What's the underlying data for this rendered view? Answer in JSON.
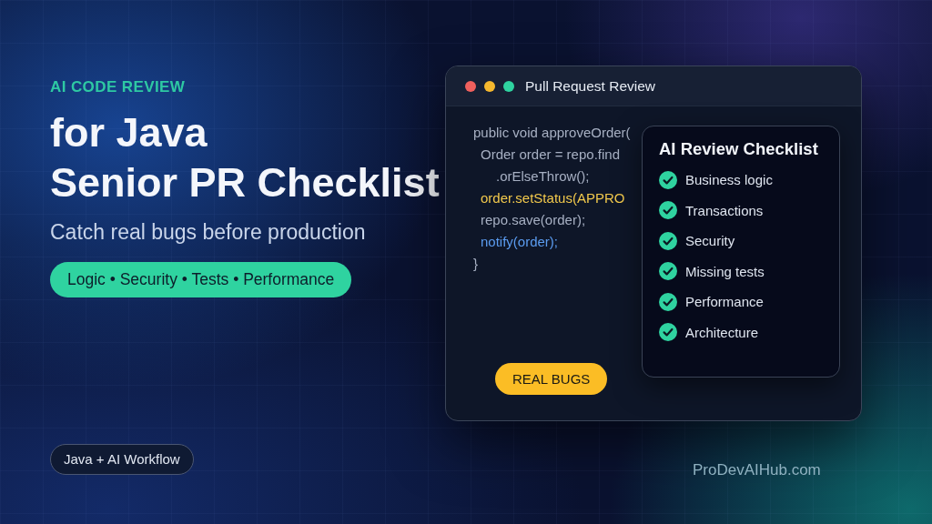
{
  "hero": {
    "eyebrow": "AI CODE REVIEW",
    "title_lines": [
      "for Java",
      "Senior PR Checklist"
    ],
    "subtitle": "Catch real bugs before production",
    "tag_pill": "Logic • Security • Tests • Performance"
  },
  "window": {
    "title": "Pull Request Review",
    "code": [
      {
        "text": "public void approveOrder(",
        "color": "#a7b0c3",
        "children": [
          {
            "text": "Order order = repo.find",
            "color": "#a7b0c3",
            "children": [
              {
                "text": ".orElseThrow();",
                "color": "#a7b0c3"
              }
            ]
          },
          {
            "text": "order.setStatus(APPRO",
            "color": "#f2c94c"
          },
          {
            "text": "repo.save(order);",
            "color": "#a7b0c3"
          },
          {
            "text": "notify(order);",
            "color": "#5b9cf0"
          }
        ]
      },
      {
        "text": "}",
        "color": "#a7b0c3"
      }
    ],
    "checklist": {
      "title": "AI Review Checklist",
      "items": [
        {
          "label": "Business logic",
          "checked": true
        },
        {
          "label": "Transactions",
          "checked": true
        },
        {
          "label": "Security",
          "checked": true
        },
        {
          "label": "Missing tests",
          "checked": true
        },
        {
          "label": "Performance",
          "checked": true
        },
        {
          "label": "Architecture",
          "checked": true
        }
      ]
    },
    "badge": "REAL BUGS"
  },
  "footer": {
    "workflow_pill": "Java + AI Workflow",
    "site": "ProDevAIHub.com"
  }
}
